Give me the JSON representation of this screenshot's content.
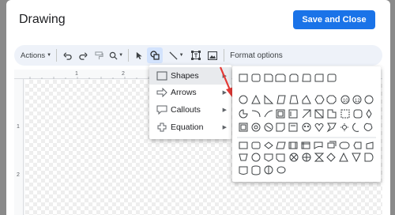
{
  "dialog": {
    "title": "Drawing",
    "save_label": "Save and Close"
  },
  "toolbar": {
    "actions_label": "Actions",
    "format_options_label": "Format options",
    "icons": [
      "undo-icon",
      "redo-icon",
      "paint-format-icon",
      "zoom-icon",
      "select-icon",
      "shape-icon",
      "line-icon",
      "textbox-icon",
      "image-icon"
    ]
  },
  "ruler": {
    "top_numbers": [
      "1",
      "2"
    ],
    "left_numbers": [
      "1",
      "2"
    ]
  },
  "shape_menu": {
    "items": [
      {
        "label": "Shapes",
        "icon": "square-icon",
        "highlighted": true
      },
      {
        "label": "Arrows",
        "icon": "arrow-icon",
        "highlighted": false
      },
      {
        "label": "Callouts",
        "icon": "callout-icon",
        "highlighted": false
      },
      {
        "label": "Equation",
        "icon": "plus-icon",
        "highlighted": false
      }
    ]
  },
  "colors": {
    "accent": "#1a73e8",
    "toolbar_bg": "#eef2f9",
    "annotation_arrow": "#e53935"
  }
}
